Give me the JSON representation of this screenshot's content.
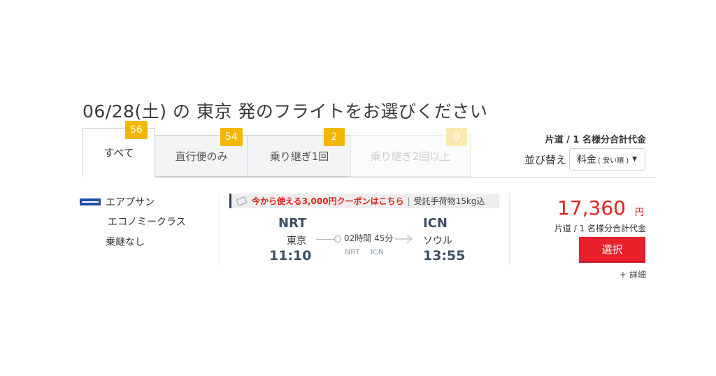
{
  "heading": "06/28(土) の 東京 発のフライトをお選びください",
  "tabs": [
    {
      "label": "すべて",
      "count": "56"
    },
    {
      "label": "直行便のみ",
      "count": "54"
    },
    {
      "label": "乗り継ぎ1回",
      "count": "2"
    },
    {
      "label": "乗り継ぎ2回以上",
      "count": "0"
    }
  ],
  "price_header": "片道 / 1 名様分合計代金",
  "sort": {
    "label": "並び替え",
    "selected": "料金",
    "selected_sub": "( 安い順 )"
  },
  "flight": {
    "airline": "エアプサン",
    "cabin": "エコノミークラス",
    "transfer": "乗継なし",
    "coupon": "今から使える3,000円クーポンはこちら",
    "coupon_separator": "|",
    "luggage": "受託手荷物15kg込",
    "depart": {
      "code": "NRT",
      "city": "東京",
      "time": "11:10"
    },
    "arrive": {
      "code": "ICN",
      "city": "ソウル",
      "time": "13:55"
    },
    "duration": "02時間 45分",
    "via": [
      "NRT",
      "ICN"
    ],
    "price": "17,360",
    "currency": "円",
    "price_note": "片道 / 1 名様分合計代金",
    "select_label": "選択",
    "details_label": "詳細",
    "details_prefix": "+"
  },
  "colors": {
    "accent_red": "#e2231a",
    "badge_yellow": "#f2b705",
    "code_blue": "#3c4f63"
  }
}
